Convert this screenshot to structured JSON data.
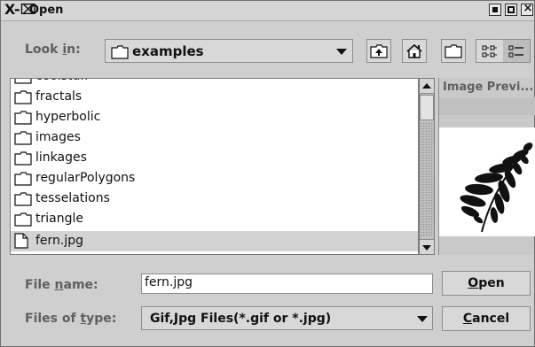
{
  "window": {
    "title": "Open",
    "title_glyph": "X-⌧"
  },
  "lookin": {
    "label_pre": "Look ",
    "label_mn": "i",
    "label_post": "n:",
    "value": "examples"
  },
  "files": [
    {
      "name": "coolstuff",
      "type": "folder"
    },
    {
      "name": "fractals",
      "type": "folder"
    },
    {
      "name": "hyperbolic",
      "type": "folder"
    },
    {
      "name": "images",
      "type": "folder"
    },
    {
      "name": "linkages",
      "type": "folder"
    },
    {
      "name": "regularPolygons",
      "type": "folder"
    },
    {
      "name": "tesselations",
      "type": "folder"
    },
    {
      "name": "triangle",
      "type": "folder"
    },
    {
      "name": "fern.jpg",
      "type": "file",
      "selected": true
    }
  ],
  "preview": {
    "label": "Image Previ..."
  },
  "filename": {
    "label_pre": "File ",
    "label_mn": "n",
    "label_post": "ame:",
    "value": "fern.jpg"
  },
  "filetype": {
    "label_pre": "Files of ",
    "label_mn": "t",
    "label_post": "ype:",
    "value": "Gif,Jpg Files(*.gif or *.jpg)"
  },
  "buttons": {
    "open": {
      "mn": "O",
      "rest": "pen"
    },
    "cancel": {
      "mn": "C",
      "rest": "ancel"
    }
  },
  "colors": {
    "window_bg": "#cfcfcf",
    "list_bg": "#ffffff",
    "selection": "#d3d3d3"
  }
}
